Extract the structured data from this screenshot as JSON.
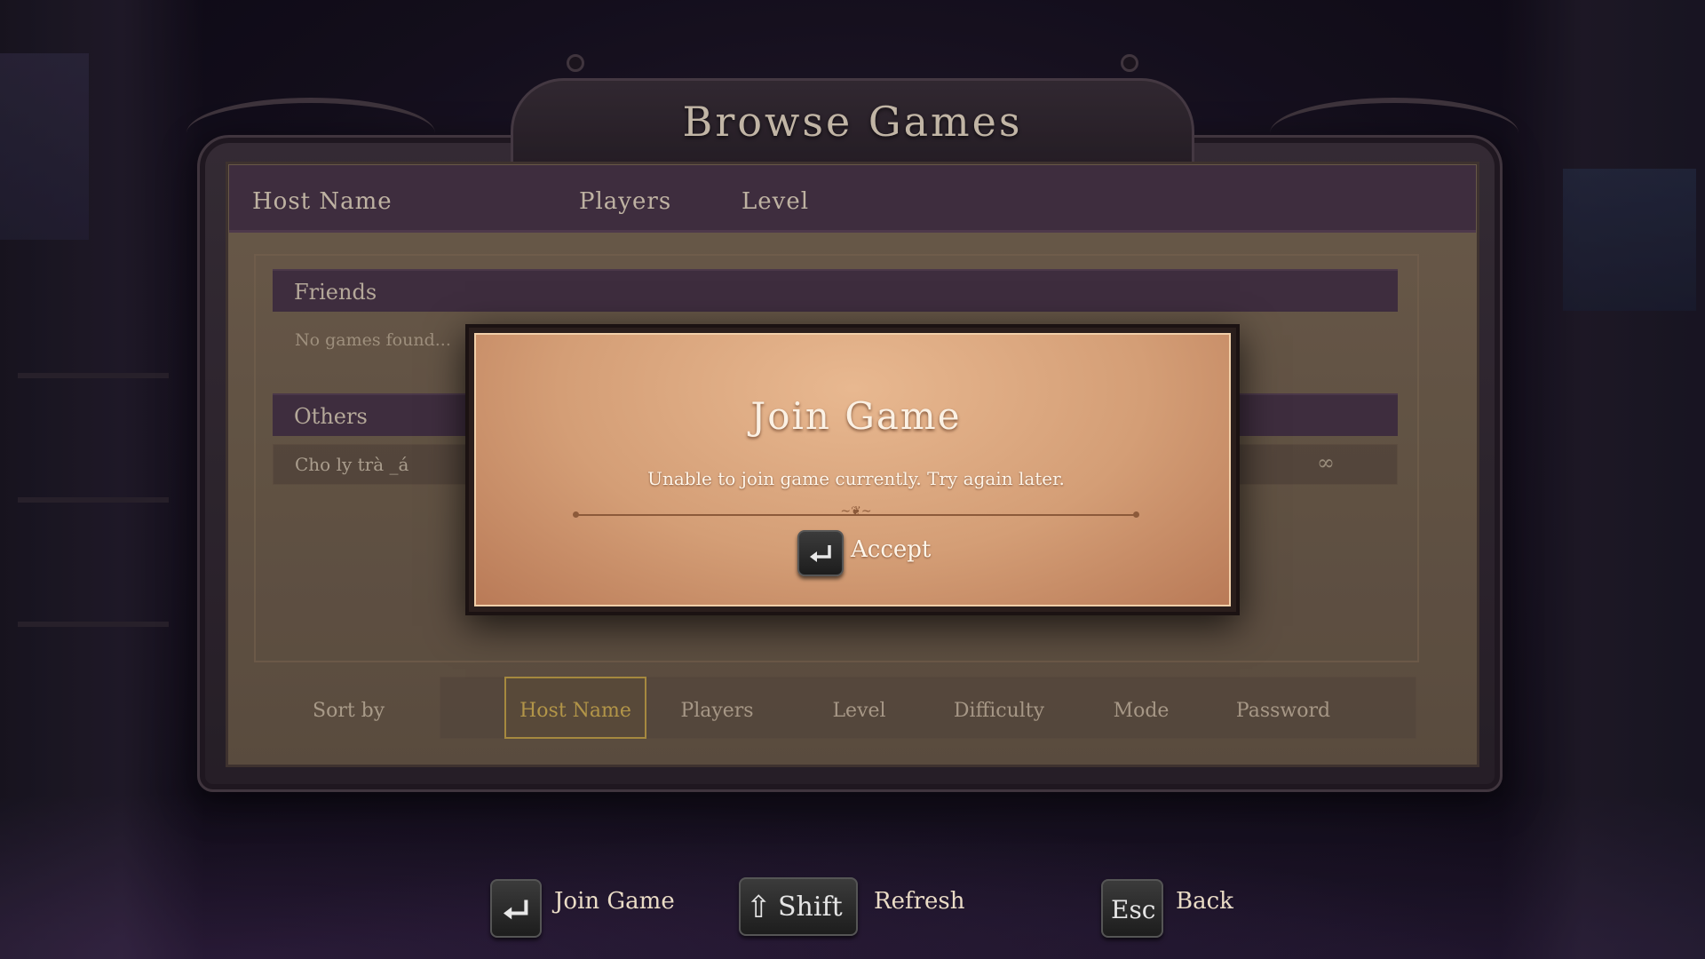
{
  "title": "Browse Games",
  "columns": [
    "Host Name",
    "Players",
    "Level"
  ],
  "sections": {
    "friends": {
      "label": "Friends",
      "empty": "No games found..."
    },
    "others": {
      "label": "Others",
      "rows": [
        {
          "host": "Cho ly trà _á",
          "extra": "∞"
        }
      ]
    }
  },
  "sort": {
    "label": "Sort by",
    "options": [
      "Host Name",
      "Players",
      "Level",
      "Difficulty",
      "Mode",
      "Password"
    ],
    "selected": "Host Name"
  },
  "modal": {
    "title": "Join Game",
    "message": "Unable to join game currently. Try again later.",
    "accept_label": "Accept",
    "accept_key": "enter-icon"
  },
  "prompts": [
    {
      "key": "enter-icon",
      "label": "Join Game"
    },
    {
      "key": "Shift",
      "label": "Refresh"
    },
    {
      "key": "Esc",
      "label": "Back"
    }
  ]
}
